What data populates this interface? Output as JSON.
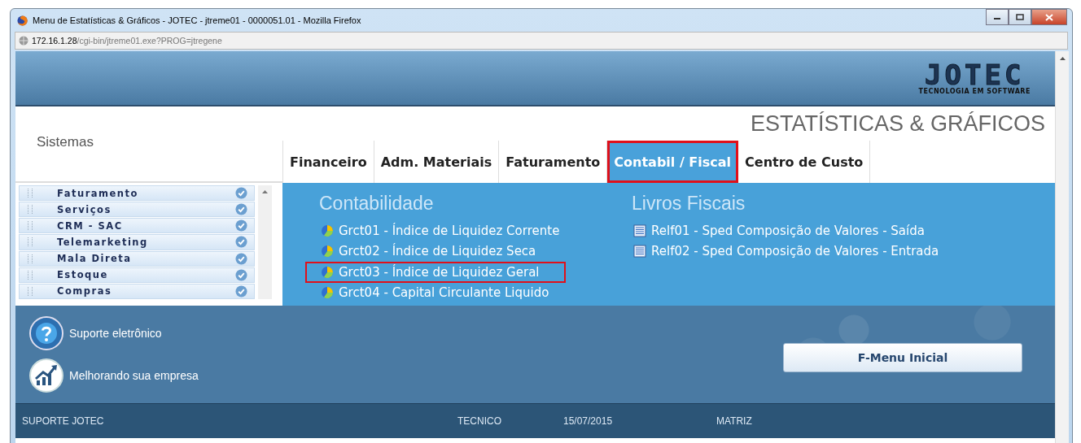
{
  "window": {
    "title": "Menu de Estatísticas & Gráficos - JOTEC - jtreme01 - 0000051.01 - Mozilla Firefox"
  },
  "address_bar": {
    "host": "172.16.1.28",
    "path": "/cgi-bin/jtreme01.exe?PROG=jtregene"
  },
  "logo": {
    "name": "JOTEC",
    "tagline": "TECNOLOGIA EM SOFTWARE"
  },
  "page_title": "ESTATÍSTICAS & GRÁFICOS",
  "sidebar": {
    "title": "Sistemas",
    "items": [
      {
        "label": "Faturamento"
      },
      {
        "label": "Serviços"
      },
      {
        "label": "CRM - SAC"
      },
      {
        "label": "Telemarketing"
      },
      {
        "label": "Mala Direta"
      },
      {
        "label": "Estoque"
      },
      {
        "label": "Compras"
      }
    ]
  },
  "tabs": [
    {
      "label": "Financeiro",
      "selected": false
    },
    {
      "label": "Adm. Materiais",
      "selected": false
    },
    {
      "label": "Faturamento",
      "selected": false
    },
    {
      "label": "Contabil / Fiscal",
      "selected": true
    },
    {
      "label": "Centro de Custo",
      "selected": false
    }
  ],
  "sections": [
    {
      "title": "Contabilidade",
      "kind": "chart",
      "items": [
        {
          "label": "Grct01 - Índice de Liquidez Corrente",
          "highlighted": false
        },
        {
          "label": "Grct02 - Índice de Liquidez Seca",
          "highlighted": false
        },
        {
          "label": "Grct03 - Índice de Liquidez Geral",
          "highlighted": true
        },
        {
          "label": "Grct04 - Capital Circulante Liquido",
          "highlighted": false
        }
      ]
    },
    {
      "title": "Livros Fiscais",
      "kind": "report",
      "items": [
        {
          "label": "Relf01 - Sped Composição de Valores - Saída",
          "highlighted": false
        },
        {
          "label": "Relf02 - Sped Composição de Valores - Entrada",
          "highlighted": false
        }
      ]
    }
  ],
  "support_links": [
    {
      "label": "Suporte eletrônico",
      "kind": "help"
    },
    {
      "label": "Melhorando sua empresa",
      "kind": "growth"
    }
  ],
  "home_button": "F-Menu Inicial",
  "status_bar": [
    "SUPORTE JOTEC",
    "TECNICO",
    "15/07/2015",
    "MATRIZ"
  ]
}
